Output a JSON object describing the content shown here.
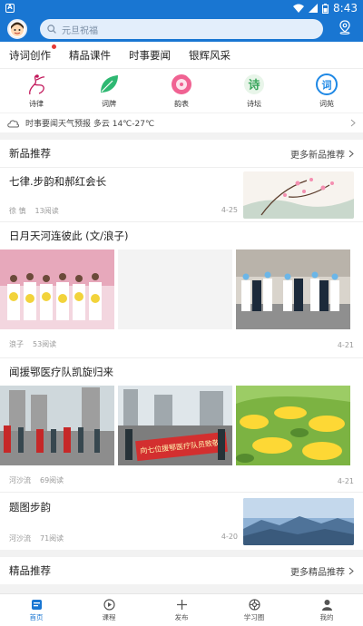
{
  "status": {
    "time": "8:43",
    "app_letter": "A"
  },
  "search": {
    "placeholder": "元旦祝福"
  },
  "tabs": [
    {
      "label": "诗词创作",
      "badge": true
    },
    {
      "label": "精品课件"
    },
    {
      "label": "时事要闻"
    },
    {
      "label": "银辉风采"
    }
  ],
  "grid": [
    {
      "label": "诗律",
      "icon": "dancer-icon",
      "color": "#c2185b"
    },
    {
      "label": "词牌",
      "icon": "leaf-icon",
      "color": "#2eb872"
    },
    {
      "label": "韵表",
      "icon": "vinyl-icon",
      "color": "#f06292"
    },
    {
      "label": "诗坛",
      "icon": "poetry-altar-icon",
      "color": "#3aa65c"
    },
    {
      "label": "词苑",
      "icon": "ci-garden-icon",
      "color": "#1e88e5"
    }
  ],
  "weather": {
    "text": "时事要闻天气预报 多云 14℃-27℃"
  },
  "new_section": {
    "title": "新品推荐",
    "more": "更多新品推荐",
    "articles": [
      {
        "title": "七律.步韵和郝红会长",
        "author": "徐 慎",
        "reads": "13阅读",
        "date": "4-25"
      },
      {
        "title": "日月天河连彼此 (文/浪子)",
        "author": "浪子",
        "reads": "53阅读",
        "date": "4-21"
      },
      {
        "title": "闻援鄂医疗队凯旋归来",
        "author": "河沙流",
        "reads": "69阅读",
        "date": "4-21"
      },
      {
        "title": "题图步韵",
        "author": "河沙流",
        "reads": "71阅读",
        "date": "4-20"
      }
    ]
  },
  "premium_section": {
    "title": "精品推荐",
    "more": "更多精品推荐"
  },
  "banner_text": "向七位援鄂医疗队员致敬",
  "bottom_nav": [
    {
      "label": "首页",
      "icon": "home-icon",
      "active": true
    },
    {
      "label": "课程",
      "icon": "play-icon"
    },
    {
      "label": "发布",
      "icon": "plus-icon"
    },
    {
      "label": "学习圈",
      "icon": "aperture-icon"
    },
    {
      "label": "我的",
      "icon": "person-icon"
    }
  ],
  "colors": {
    "primary": "#1976d2",
    "badge": "#e53935"
  }
}
